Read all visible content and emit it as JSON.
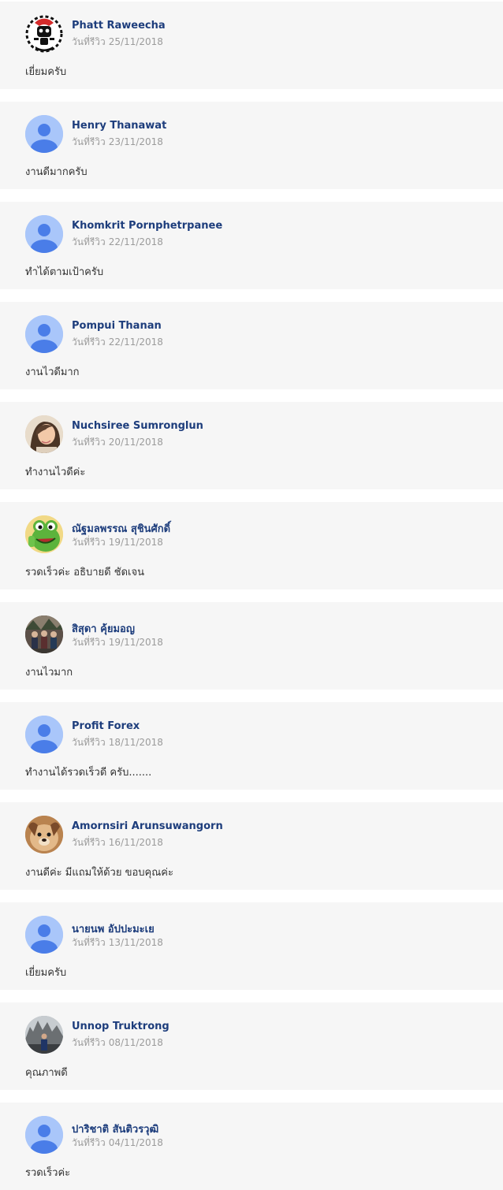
{
  "date_label": "วันที่รีวิว",
  "reviews": [
    {
      "name": "Phatt Raweecha",
      "date": "25/11/2018",
      "text": "เยี่ยมครับ",
      "avatar": "robot-avatar"
    },
    {
      "name": "Henry Thanawat",
      "date": "23/11/2018",
      "text": "งานดีมากครับ",
      "avatar": "default-avatar"
    },
    {
      "name": "Khomkrit Pornphetrpanee",
      "date": "22/11/2018",
      "text": "ทำได้ตามเป้าครับ",
      "avatar": "default-avatar"
    },
    {
      "name": "Pompui Thanan",
      "date": "22/11/2018",
      "text": "งานไวดีมาก",
      "avatar": "default-avatar"
    },
    {
      "name": "Nuchsiree Sumronglun",
      "date": "20/11/2018",
      "text": "ทำงานไวดีค่ะ",
      "avatar": "portrait-woman-avatar"
    },
    {
      "name": "ณัฐมลพรรณ สุชินศักดิ์",
      "date": "19/11/2018",
      "text": "รวดเร็วค่ะ อธิบายดี ชัดเจน",
      "avatar": "cartoon-frog-avatar"
    },
    {
      "name": "สิสุดา คุ้ยมอญ",
      "date": "19/11/2018",
      "text": "งานไวมาก",
      "avatar": "group-photo-avatar"
    },
    {
      "name": "Profit Forex",
      "date": "18/11/2018",
      "text": "ทำงานได้รวดเร็วดี ครับ.......",
      "avatar": "default-avatar"
    },
    {
      "name": "Amornsiri Arunsuwangorn",
      "date": "16/11/2018",
      "text": "งานดีค่ะ มีแถมให้ด้วย ขอบคุณค่ะ",
      "avatar": "dog-avatar"
    },
    {
      "name": "นายนพ อัปปะมะเย",
      "date": "13/11/2018",
      "text": "เยี่ยมครับ",
      "avatar": "default-avatar"
    },
    {
      "name": "Unnop Truktrong",
      "date": "08/11/2018",
      "text": "คุณภาพดี",
      "avatar": "landmark-photo-avatar"
    },
    {
      "name": "ปาริชาติ สันติวรวุฒิ",
      "date": "04/11/2018",
      "text": "รวดเร็วค่ะ",
      "avatar": "default-avatar"
    }
  ],
  "colors": {
    "card_background": "#f6f6f6",
    "name": "#1d3d7c",
    "date": "#9b9b9b",
    "text": "#333333",
    "default_avatar_bg": "#a9c6fa",
    "default_avatar_fg": "#4a7de8"
  }
}
